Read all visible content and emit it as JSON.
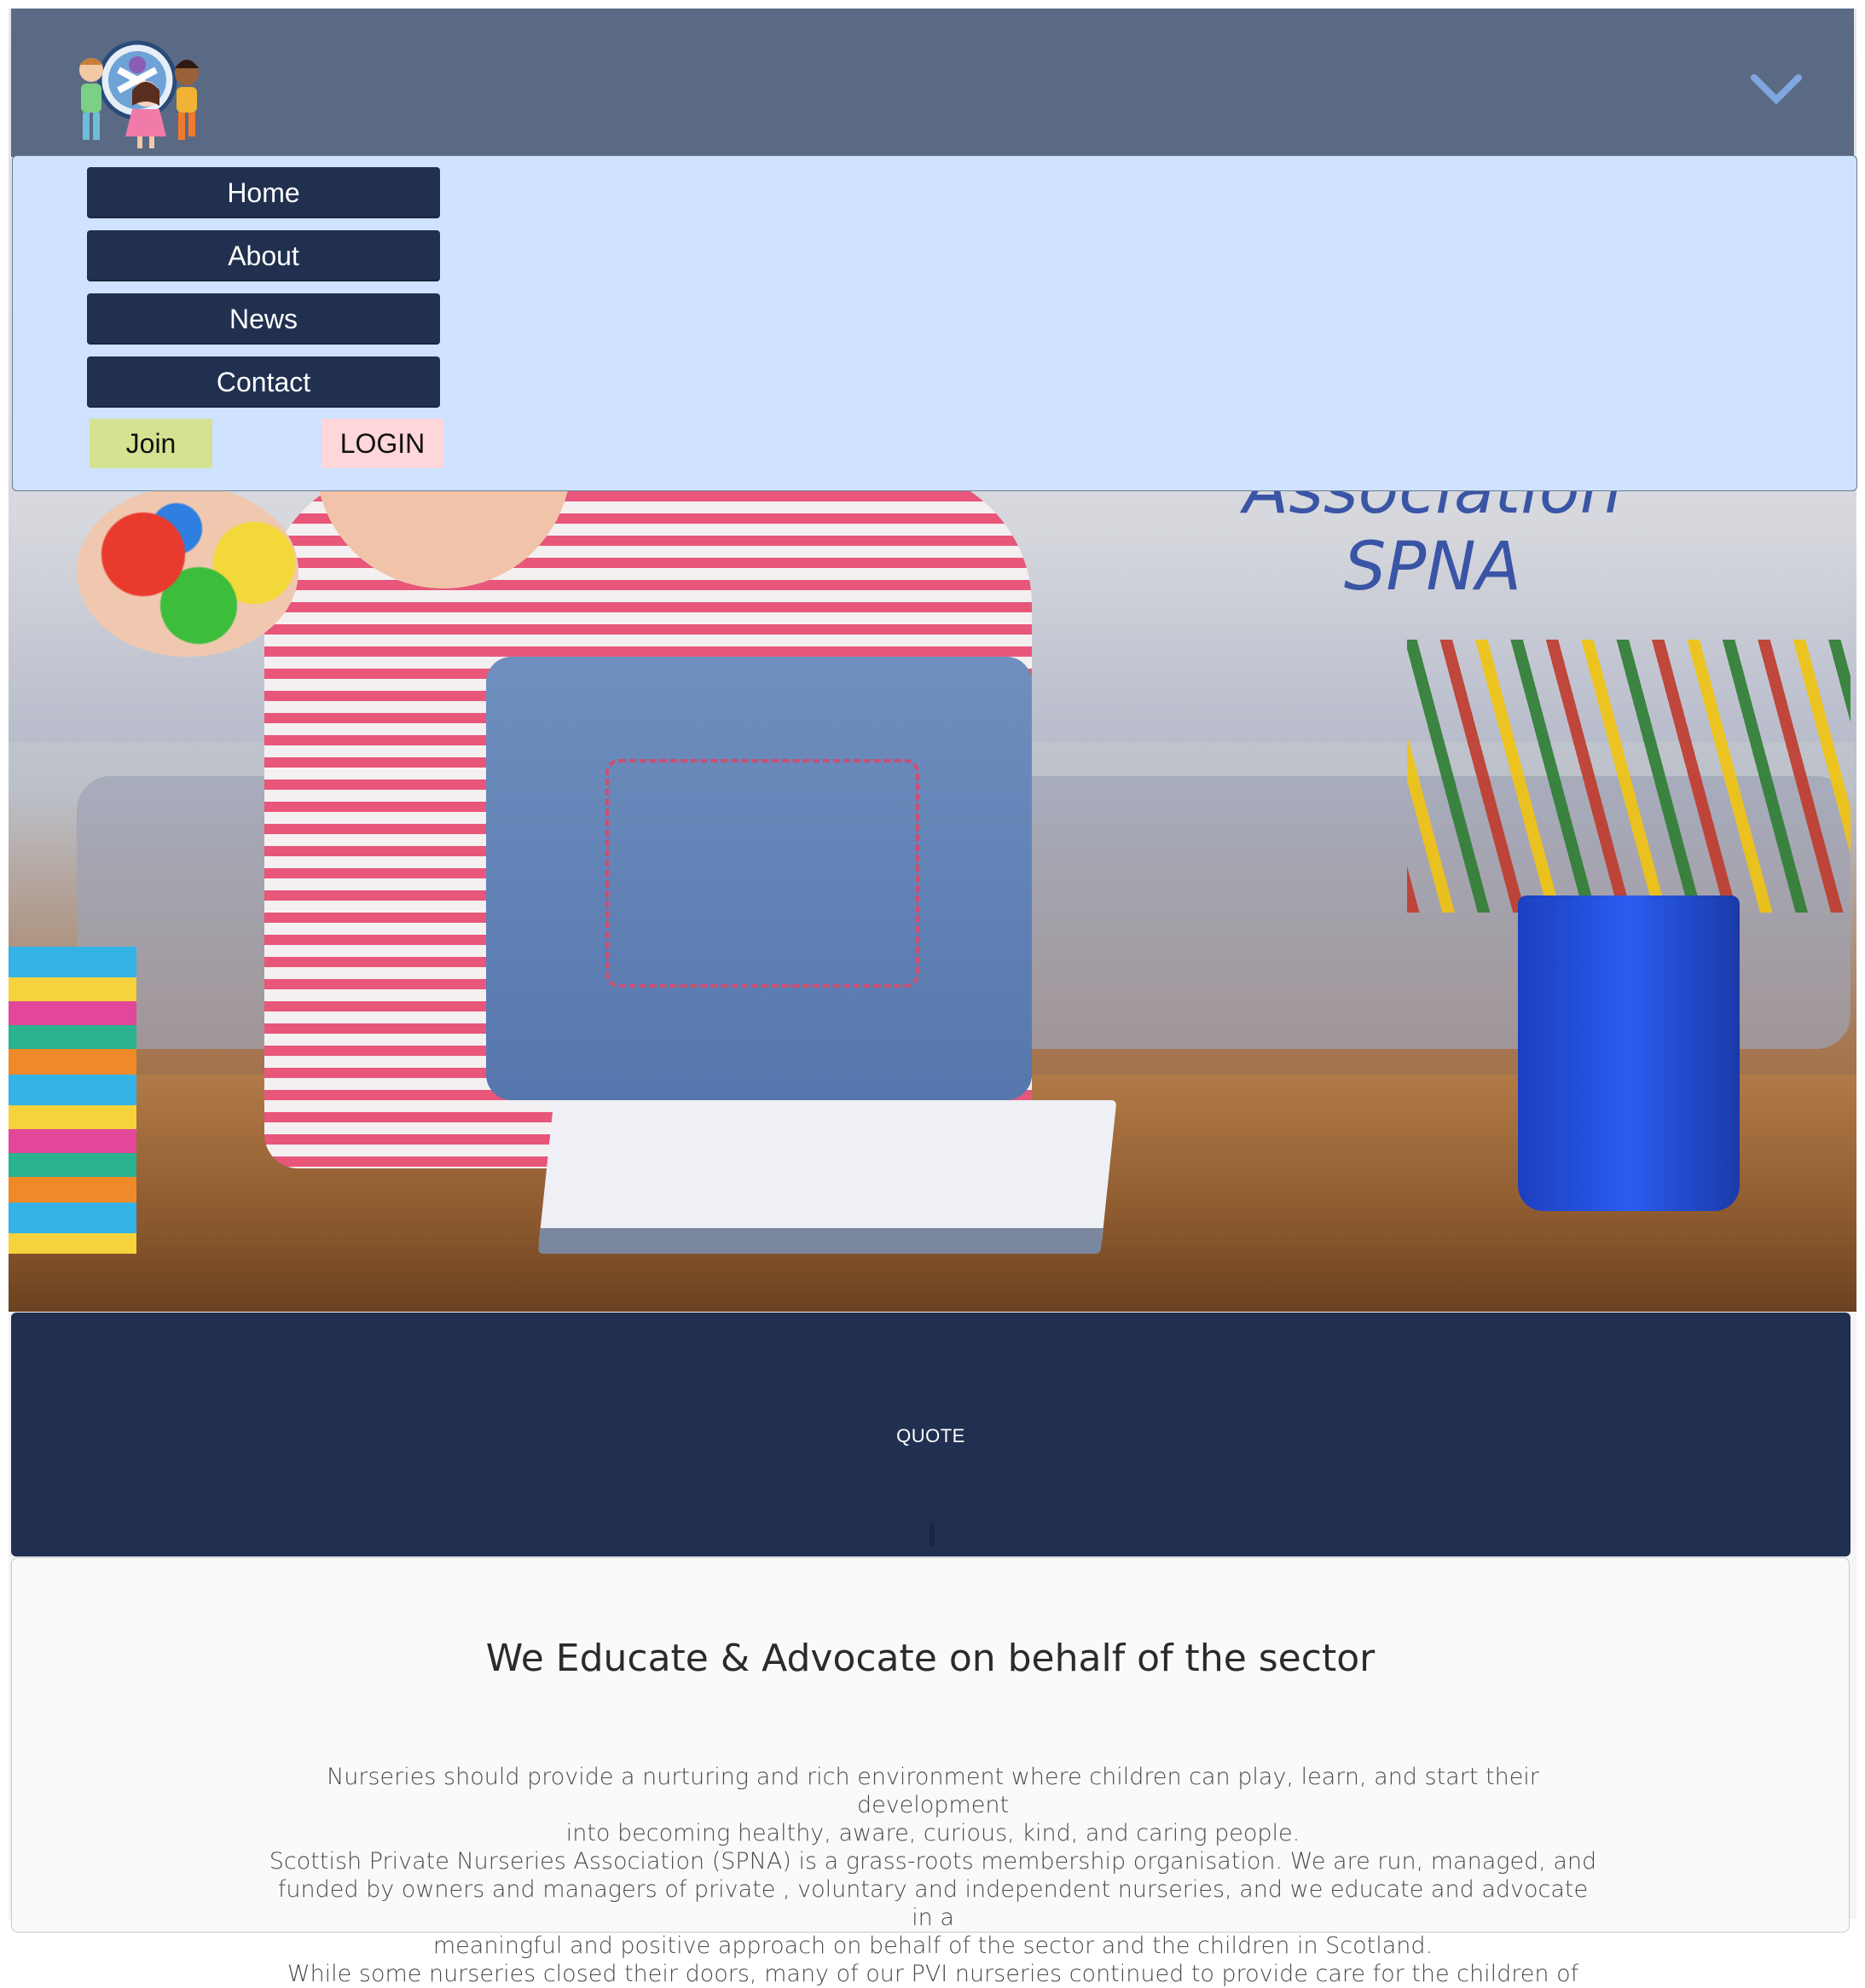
{
  "hero": {
    "title_lines": [
      "Association",
      "SPNA"
    ]
  },
  "header": {
    "logo_icon": "children-logo-icon",
    "menu_toggle_icon": "chevron-down-icon",
    "chevron_color": "#7fa6e0"
  },
  "menu": {
    "items": [
      {
        "label": "Home"
      },
      {
        "label": "About"
      },
      {
        "label": "News"
      },
      {
        "label": "Contact"
      }
    ],
    "join_label": "Join",
    "login_label": "LOGIN"
  },
  "quote": {
    "label": "QUOTE"
  },
  "intro": {
    "heading": "We Educate & Advocate on behalf of the sector",
    "lines": [
      "Nurseries should provide a nurturing and rich environment where children can play, learn, and start their development",
      "into becoming healthy, aware, curious, kind, and caring people.",
      "Scottish Private Nurseries Association (SPNA) is a grass-roots membership organisation. We are run, managed, and",
      "funded by owners and managers of private , voluntary and independent nurseries, and we educate and advocate in a",
      "meaningful and positive approach on behalf of the sector and the children in Scotland.",
      "While some nurseries closed their doors, many of our PVI nurseries continued to provide care for the children of"
    ]
  },
  "colors": {
    "navy": "#21304f",
    "menu_bg": "#cfe2ff",
    "join_bg": "#d4e391",
    "login_bg": "#ffd6d9",
    "title_blue": "#3a55a6"
  }
}
